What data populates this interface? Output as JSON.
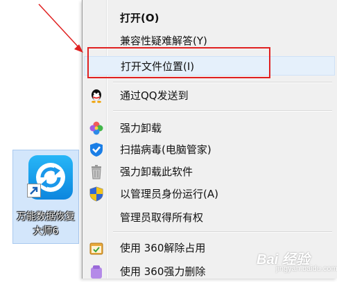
{
  "menu": {
    "items": [
      {
        "label": "打开(O)",
        "icon": "none"
      },
      {
        "label": "兼容性疑难解答(Y)",
        "icon": "none"
      },
      {
        "label": "打开文件位置(I)",
        "icon": "none"
      },
      {
        "label": "通过QQ发送到",
        "icon": "qq-penguin-icon"
      },
      {
        "label": "强力卸载",
        "icon": "colorful-petal-icon"
      },
      {
        "label": "扫描病毒(电脑管家)",
        "icon": "shield-check-icon"
      },
      {
        "label": "强力卸载此软件",
        "icon": "trash-can-icon"
      },
      {
        "label": "以管理员身份运行(A)",
        "icon": "uac-shield-icon"
      },
      {
        "label": "管理员取得所有权",
        "icon": "none"
      },
      {
        "label": "使用 360解除占用",
        "icon": "360-unlock-icon"
      },
      {
        "label": "使用 360强力删除",
        "icon": "360-delete-icon"
      }
    ]
  },
  "desktop_icon": {
    "label_line1": "万能数据恢复",
    "label_line2": "大师6",
    "icon": "refresh-arrows-icon"
  },
  "watermark": {
    "text": "Bai 经验",
    "sub": "jingyan.baidu.com"
  },
  "colors": {
    "annotation_red": "#e02020",
    "menu_bg": "#f0f0f0",
    "highlight_bg": "#e5f0fb",
    "icon_blue": "#1a98ea"
  }
}
